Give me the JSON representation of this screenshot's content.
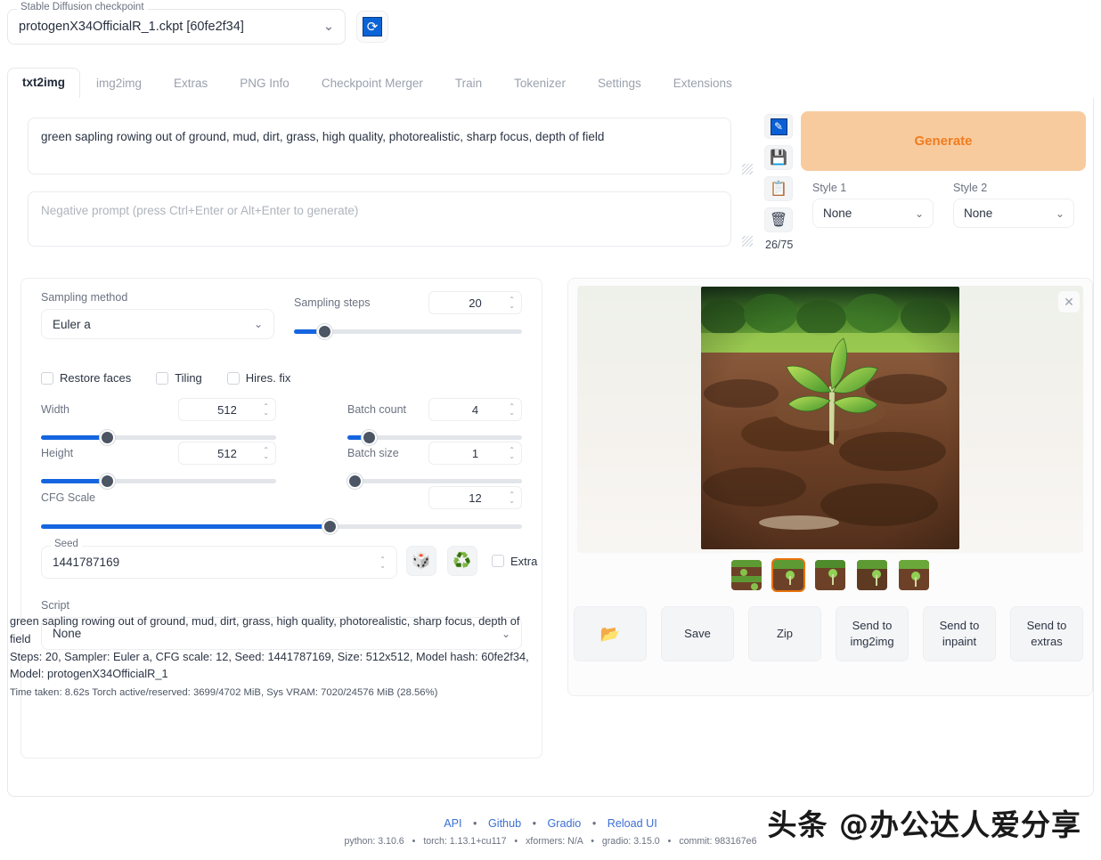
{
  "checkpoint": {
    "label": "Stable Diffusion checkpoint",
    "value": "protogenX34OfficialR_1.ckpt [60fe2f34]",
    "caret": "⌄",
    "refresh_icon": "refresh-icon"
  },
  "tabs": [
    {
      "label": "txt2img",
      "active": true
    },
    {
      "label": "img2img",
      "active": false
    },
    {
      "label": "Extras",
      "active": false
    },
    {
      "label": "PNG Info",
      "active": false
    },
    {
      "label": "Checkpoint Merger",
      "active": false
    },
    {
      "label": "Train",
      "active": false
    },
    {
      "label": "Tokenizer",
      "active": false
    },
    {
      "label": "Settings",
      "active": false
    },
    {
      "label": "Extensions",
      "active": false
    }
  ],
  "prompt": {
    "value": "green sapling rowing out of ground, mud, dirt, grass, high quality, photorealistic, sharp focus, depth of field",
    "negative_placeholder": "Negative prompt (press Ctrl+Enter or Alt+Enter to generate)",
    "token_count": "26/75"
  },
  "toolbar_icons": [
    {
      "name": "arrow-pen-icon",
      "glyph": "↗"
    },
    {
      "name": "floppy-save-icon",
      "glyph": "💾"
    },
    {
      "name": "clipboard-icon",
      "glyph": "📋"
    },
    {
      "name": "trash-icon",
      "glyph": "🗑"
    }
  ],
  "generate": {
    "label": "Generate",
    "color": "#f8cb9f",
    "text_color": "#f07c1e"
  },
  "styles": [
    {
      "label": "Style 1",
      "value": "None"
    },
    {
      "label": "Style 2",
      "value": "None"
    }
  ],
  "settings": {
    "sampling_method": {
      "label": "Sampling method",
      "value": "Euler a"
    },
    "sampling_steps": {
      "label": "Sampling steps",
      "value": "20",
      "pct": 12
    },
    "checkboxes": [
      {
        "label": "Restore faces",
        "checked": false
      },
      {
        "label": "Tiling",
        "checked": false
      },
      {
        "label": "Hires. fix",
        "checked": false
      }
    ],
    "width": {
      "label": "Width",
      "value": "512",
      "pct": 25
    },
    "height": {
      "label": "Height",
      "value": "512",
      "pct": 25
    },
    "batch_count": {
      "label": "Batch count",
      "value": "4",
      "pct": 16
    },
    "batch_size": {
      "label": "Batch size",
      "value": "1",
      "pct": 0
    },
    "cfg_scale": {
      "label": "CFG Scale",
      "value": "12",
      "pct": 60
    },
    "seed": {
      "label": "Seed",
      "value": "1441787169"
    },
    "dice_button": "dice-icon",
    "recycle_button": "recycle-icon",
    "extra": {
      "label": "Extra",
      "checked": false
    },
    "script": {
      "label": "Script",
      "value": "None"
    }
  },
  "results": {
    "close_label": "✕",
    "thumbnail_count": 5,
    "selected_thumbnail": 1,
    "actions": [
      {
        "label": "",
        "icon": "folder-icon",
        "name": "open-folder-button"
      },
      {
        "label": "Save",
        "icon": "",
        "name": "save-button"
      },
      {
        "label": "Zip",
        "icon": "",
        "name": "zip-button"
      },
      {
        "label": "Send to img2img",
        "icon": "",
        "name": "send-to-img2img-button"
      },
      {
        "label": "Send to inpaint",
        "icon": "",
        "name": "send-to-inpaint-button"
      },
      {
        "label": "Send to extras",
        "icon": "",
        "name": "send-to-extras-button"
      }
    ],
    "info_prompt": "green sapling rowing out of ground, mud, dirt, grass, high quality, photorealistic, sharp focus, depth of field",
    "info_params": "Steps: 20, Sampler: Euler a, CFG scale: 12, Seed: 1441787169, Size: 512x512, Model hash: 60fe2f34, Model: protogenX34OfficialR_1",
    "info_perf": "Time taken: 8.62s  Torch active/reserved: 3699/4702 MiB, Sys VRAM: 7020/24576 MiB (28.56%)"
  },
  "footer": {
    "links": [
      "API",
      "Github",
      "Gradio",
      "Reload UI"
    ],
    "separator": "•",
    "versions": [
      "python: 3.10.6",
      "torch: 1.13.1+cu117",
      "xformers: N/A",
      "gradio: 3.15.0",
      "commit: 983167e6"
    ]
  },
  "watermark": {
    "text": "头条 @办公达人爱分享"
  }
}
